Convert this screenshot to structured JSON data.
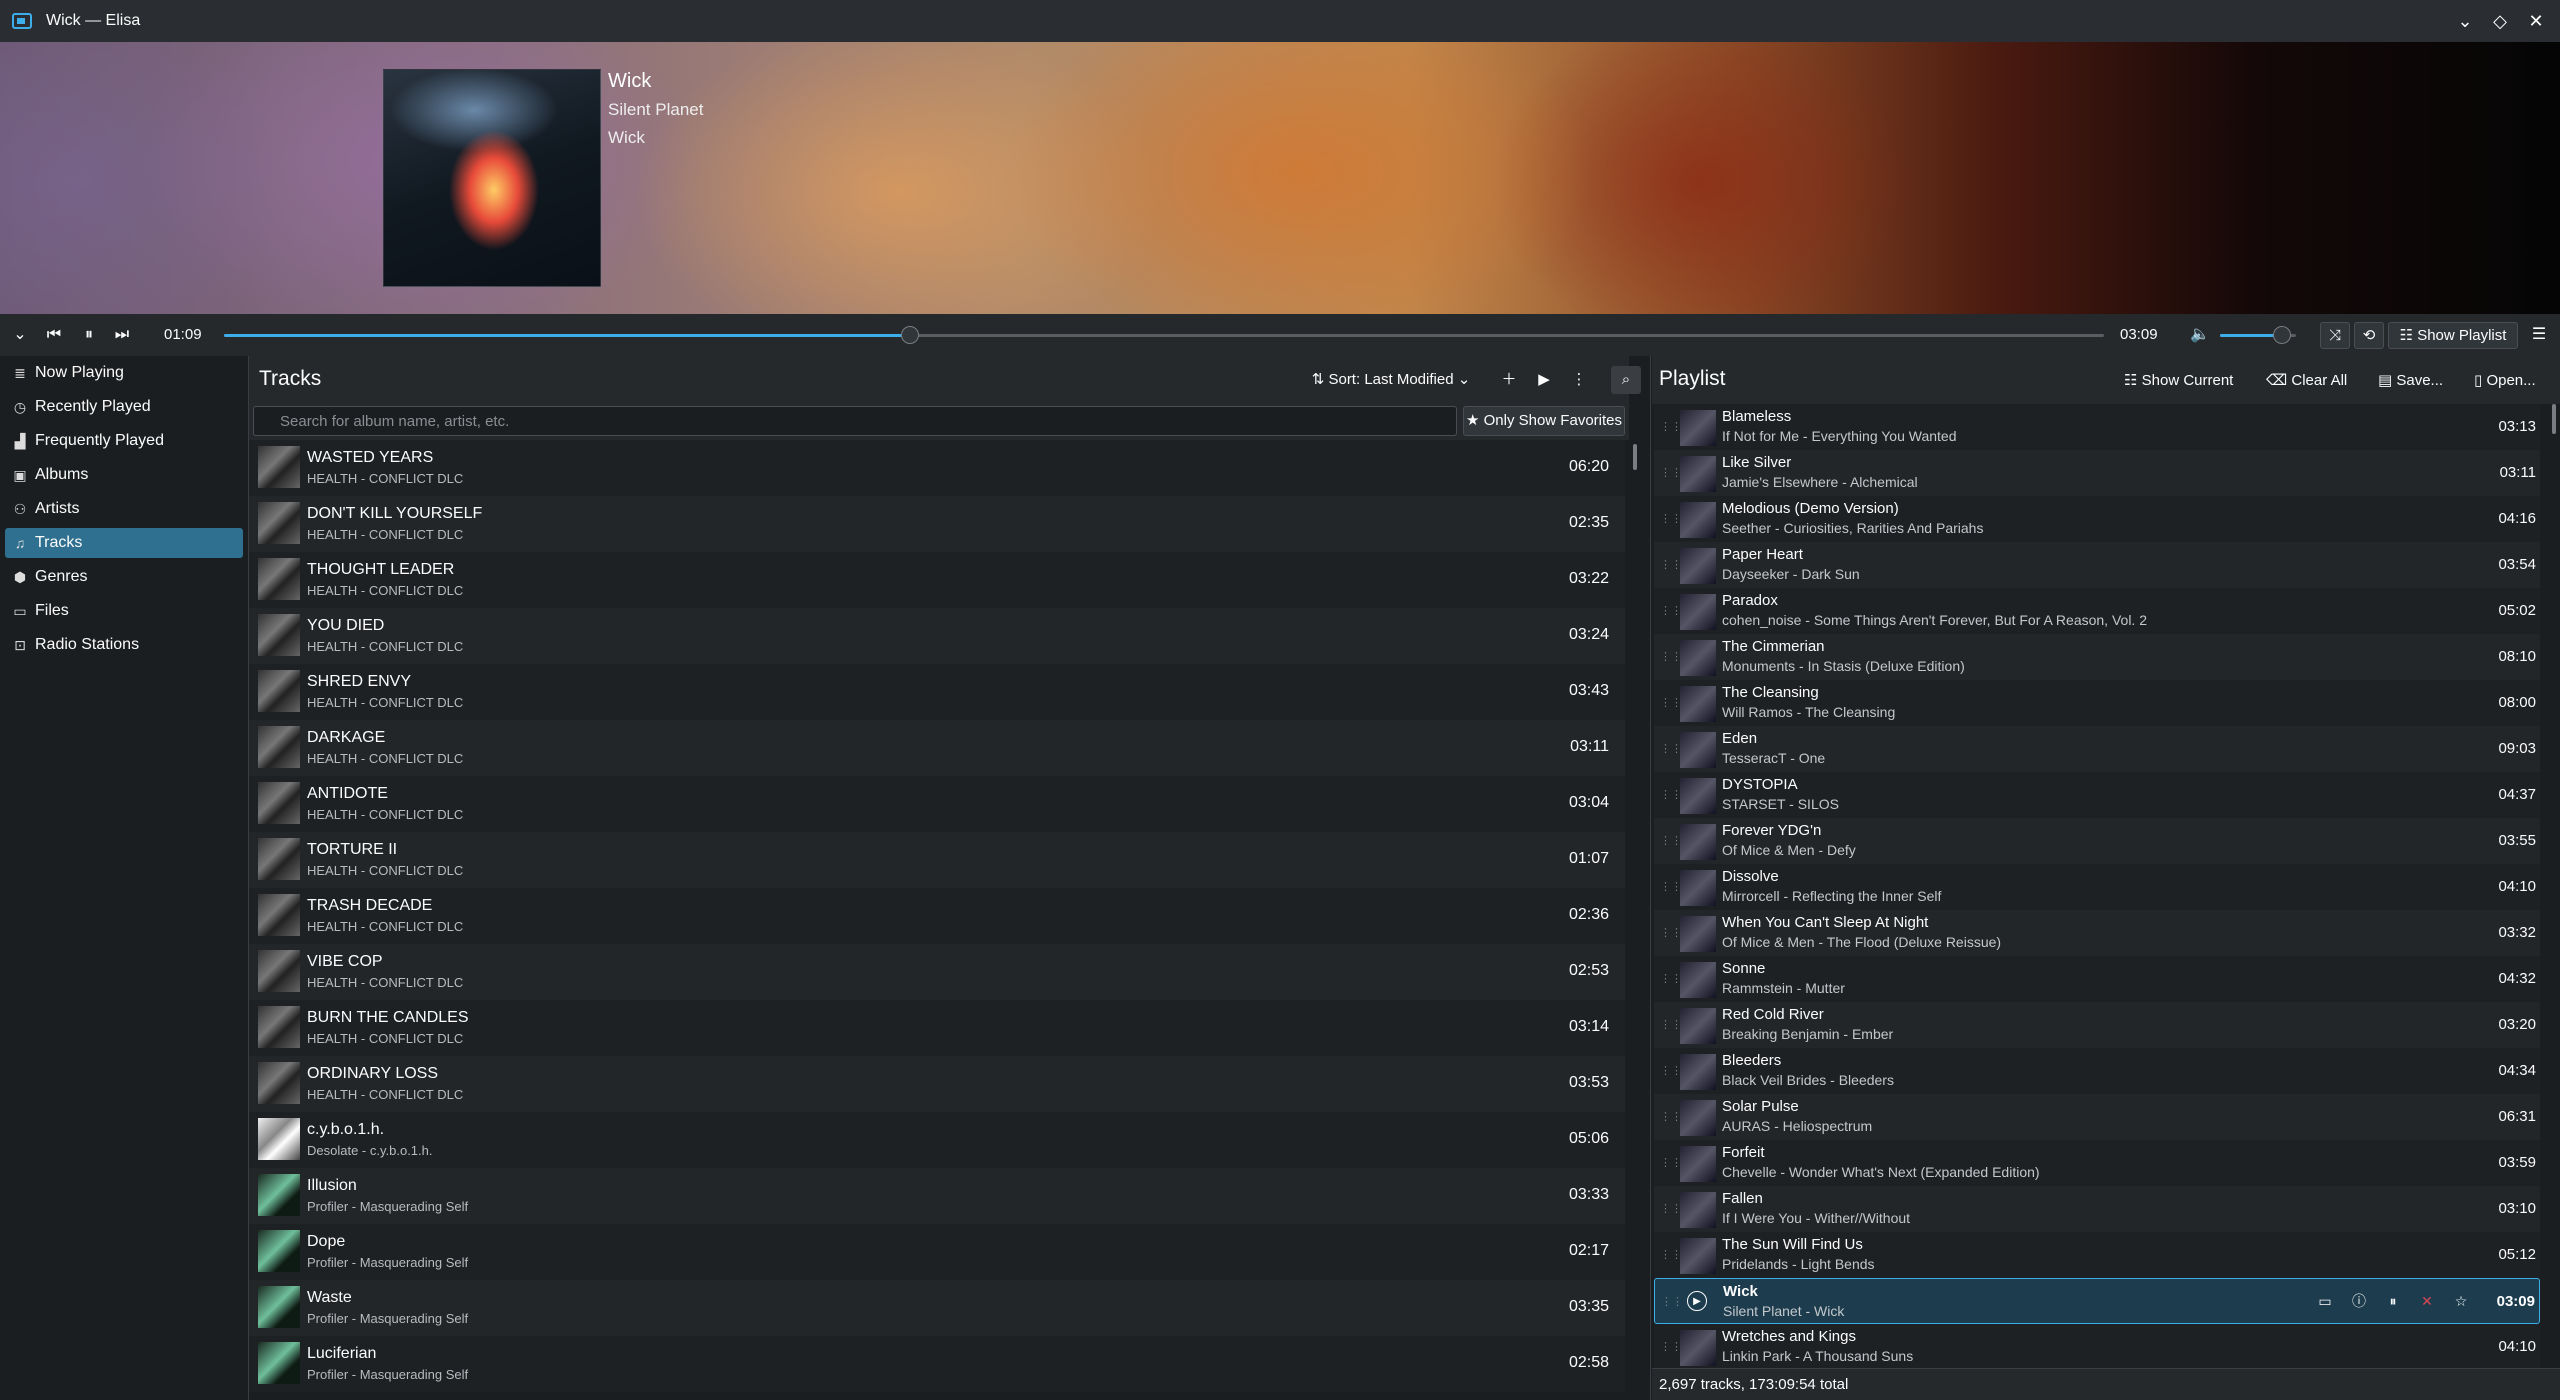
{
  "window": {
    "title": "Wick — Elisa"
  },
  "now_playing": {
    "title": "Wick",
    "artist": "Silent Planet",
    "album": "Wick"
  },
  "transport": {
    "elapsed": "01:09",
    "duration": "03:09",
    "progress": 0.365,
    "volume": 0.82,
    "show_playlist_label": "Show Playlist"
  },
  "sidebar": {
    "items": [
      {
        "label": "Now Playing",
        "icon": "now-playing-icon"
      },
      {
        "label": "Recently Played",
        "icon": "recent-icon"
      },
      {
        "label": "Frequently Played",
        "icon": "bar-chart-icon"
      },
      {
        "label": "Albums",
        "icon": "album-icon"
      },
      {
        "label": "Artists",
        "icon": "artist-icon"
      },
      {
        "label": "Tracks",
        "icon": "music-note-icon",
        "active": true
      },
      {
        "label": "Genres",
        "icon": "genre-icon"
      },
      {
        "label": "Files",
        "icon": "folder-icon"
      },
      {
        "label": "Radio Stations",
        "icon": "radio-icon"
      }
    ]
  },
  "tracks_view": {
    "title": "Tracks",
    "sort_label": "Sort: Last Modified",
    "search_placeholder": "Search for album name, artist, etc.",
    "favorites_label": "Only Show Favorites",
    "rows": [
      {
        "title": "WASTED YEARS",
        "subtitle": "HEALTH - CONFLICT DLC",
        "duration": "06:20"
      },
      {
        "title": "DON'T KILL YOURSELF",
        "subtitle": "HEALTH - CONFLICT DLC",
        "duration": "02:35"
      },
      {
        "title": "THOUGHT LEADER",
        "subtitle": "HEALTH - CONFLICT DLC",
        "duration": "03:22"
      },
      {
        "title": "YOU DIED",
        "subtitle": "HEALTH - CONFLICT DLC",
        "duration": "03:24"
      },
      {
        "title": "SHRED ENVY",
        "subtitle": "HEALTH - CONFLICT DLC",
        "duration": "03:43"
      },
      {
        "title": "DARKAGE",
        "subtitle": "HEALTH - CONFLICT DLC",
        "duration": "03:11"
      },
      {
        "title": "ANTIDOTE",
        "subtitle": "HEALTH - CONFLICT DLC",
        "duration": "03:04"
      },
      {
        "title": "TORTURE II",
        "subtitle": "HEALTH - CONFLICT DLC",
        "duration": "01:07"
      },
      {
        "title": "TRASH DECADE",
        "subtitle": "HEALTH - CONFLICT DLC",
        "duration": "02:36"
      },
      {
        "title": "VIBE COP",
        "subtitle": "HEALTH - CONFLICT DLC",
        "duration": "02:53"
      },
      {
        "title": "BURN THE CANDLES",
        "subtitle": "HEALTH - CONFLICT DLC",
        "duration": "03:14"
      },
      {
        "title": "ORDINARY LOSS",
        "subtitle": "HEALTH - CONFLICT DLC",
        "duration": "03:53"
      },
      {
        "title": "c.y.b.o.1.h.",
        "subtitle": "Desolate - c.y.b.o.1.h.",
        "duration": "05:06"
      },
      {
        "title": "Illusion",
        "subtitle": "Profiler - Masquerading Self",
        "duration": "03:33"
      },
      {
        "title": "Dope",
        "subtitle": "Profiler - Masquerading Self",
        "duration": "02:17"
      },
      {
        "title": "Waste",
        "subtitle": "Profiler - Masquerading Self",
        "duration": "03:35"
      },
      {
        "title": "Luciferian",
        "subtitle": "Profiler - Masquerading Self",
        "duration": "02:58"
      }
    ]
  },
  "playlist": {
    "title": "Playlist",
    "show_current_label": "Show Current",
    "clear_all_label": "Clear All",
    "save_label": "Save...",
    "open_label": "Open...",
    "footer": "2,697 tracks, 173:09:54 total",
    "rows": [
      {
        "title": "Blameless",
        "subtitle": "If Not for Me - Everything You Wanted",
        "duration": "03:13"
      },
      {
        "title": "Like Silver",
        "subtitle": "Jamie's Elsewhere - Alchemical",
        "duration": "03:11"
      },
      {
        "title": "Melodious (Demo Version)",
        "subtitle": "Seether - Curiosities, Rarities And Pariahs",
        "duration": "04:16"
      },
      {
        "title": "Paper Heart",
        "subtitle": "Dayseeker - Dark Sun",
        "duration": "03:54"
      },
      {
        "title": "Paradox",
        "subtitle": "cohen_noise - Some Things Aren't Forever, But For A Reason, Vol. 2",
        "duration": "05:02"
      },
      {
        "title": "The Cimmerian",
        "subtitle": "Monuments - In Stasis (Deluxe Edition)",
        "duration": "08:10"
      },
      {
        "title": "The Cleansing",
        "subtitle": "Will Ramos - The Cleansing",
        "duration": "08:00"
      },
      {
        "title": "Eden",
        "subtitle": "TesseracT - One",
        "duration": "09:03"
      },
      {
        "title": "DYSTOPIA",
        "subtitle": "STARSET - SILOS",
        "duration": "04:37"
      },
      {
        "title": "Forever YDG'n",
        "subtitle": "Of Mice & Men - Defy",
        "duration": "03:55"
      },
      {
        "title": "Dissolve",
        "subtitle": "Mirrorcell - Reflecting the Inner Self",
        "duration": "04:10"
      },
      {
        "title": "When You Can't Sleep At Night",
        "subtitle": "Of Mice & Men - The Flood (Deluxe Reissue)",
        "duration": "03:32"
      },
      {
        "title": "Sonne",
        "subtitle": "Rammstein - Mutter",
        "duration": "04:32"
      },
      {
        "title": "Red Cold River",
        "subtitle": "Breaking Benjamin - Ember",
        "duration": "03:20"
      },
      {
        "title": "Bleeders",
        "subtitle": "Black Veil Brides - Bleeders",
        "duration": "04:34"
      },
      {
        "title": "Solar Pulse",
        "subtitle": "AURAS - Heliospectrum",
        "duration": "06:31"
      },
      {
        "title": "Forfeit",
        "subtitle": "Chevelle - Wonder What's Next (Expanded Edition)",
        "duration": "03:59"
      },
      {
        "title": "Fallen",
        "subtitle": "If I Were You - Wither//Without",
        "duration": "03:10"
      },
      {
        "title": "The Sun Will Find Us",
        "subtitle": "Pridelands - Light Bends",
        "duration": "05:12"
      },
      {
        "title": "Wick",
        "subtitle": "Silent Planet - Wick",
        "duration": "03:09",
        "current": true
      },
      {
        "title": "Wretches and Kings",
        "subtitle": "Linkin Park - A Thousand Suns",
        "duration": "04:10"
      }
    ]
  },
  "colors": {
    "accent": "#3daee9",
    "active_sidebar": "#2f6f8f"
  }
}
